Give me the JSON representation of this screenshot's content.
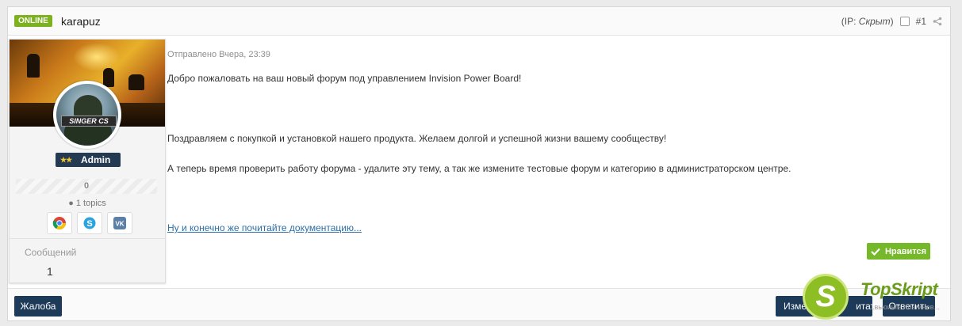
{
  "header": {
    "online_badge": "ONLINE",
    "author": "karapuz",
    "ip_label": "(IP: ",
    "ip_value": "Скрыт",
    "ip_close": ")",
    "post_number": "#1"
  },
  "sidebar": {
    "avatar_tag": "SINGER CS",
    "rank_stars": "★★",
    "rank_label": "Admin",
    "reputation": "0",
    "topics": "● 1 topics",
    "social_icons": [
      "chrome-icon",
      "skype-icon",
      "vk-icon"
    ],
    "posts_label": "Сообщений",
    "posts_value": "1"
  },
  "post": {
    "date": "Отправлено Вчера, 23:39",
    "paragraph1": "Добро пожаловать на ваш новый форум под управлением Invision Power Board!",
    "paragraph2": "Поздравляем с покупкой и установкой нашего продукта. Желаем долгой и успешной жизни вашему сообществу!",
    "paragraph3": "А теперь время проверить работу форума - удалите эту тему, а так же измените тестовые форум и категорию в администраторском центре.",
    "doc_link": "Ну и конечно же почитайте документацию..."
  },
  "actions": {
    "like_label": "Нравится",
    "report_label": "Жалоба",
    "edit_label": "Изме",
    "quote_label": "итата",
    "reply_label": "Ответить"
  },
  "watermark": {
    "letter": "S",
    "brand": "TopSkript",
    "subtitle": "...вьюинге плагинов..."
  },
  "colors": {
    "online_green": "#7bb21e",
    "like_green": "#75b82a",
    "dark_button": "#1d3a58",
    "link_blue": "#2d6ea5"
  }
}
